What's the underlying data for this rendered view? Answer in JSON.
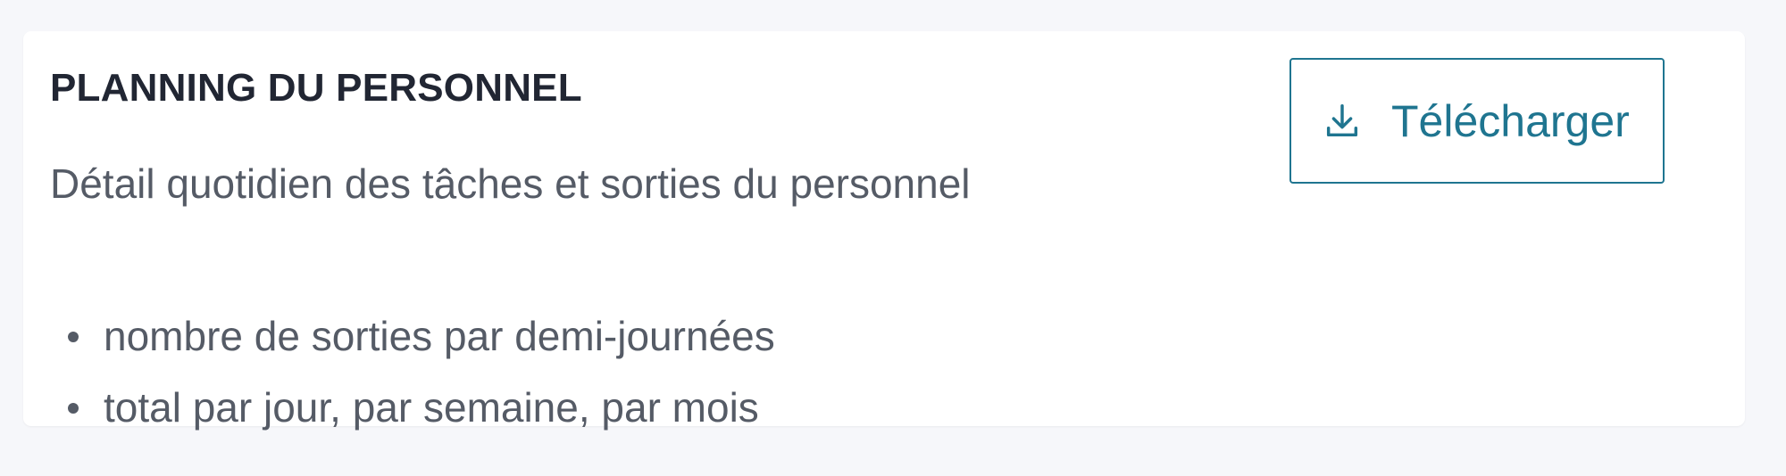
{
  "card": {
    "title": "PLANNING DU PERSONNEL",
    "description": "Détail quotidien des tâches et sorties du personnel",
    "features": [
      "nombre de sorties par demi-journées",
      "total par jour, par semaine, par mois"
    ],
    "download_button": {
      "label": "Télécharger",
      "icon": "download-icon"
    }
  },
  "colors": {
    "background": "#f6f7fa",
    "card": "#ffffff",
    "title": "#212633",
    "text": "#555b66",
    "accent": "#1f7590"
  }
}
